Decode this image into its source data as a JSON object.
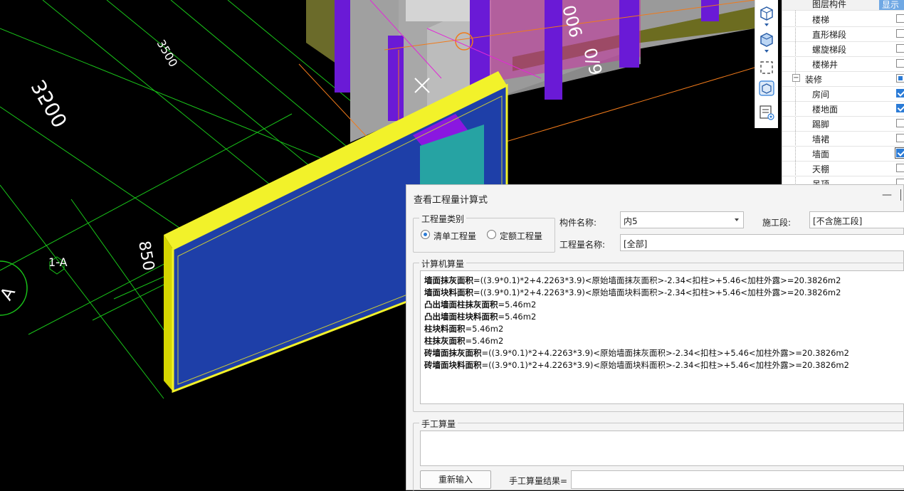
{
  "viewport": {
    "dimensions": [
      "3500",
      "3500",
      "850"
    ],
    "axis_label": "1-A",
    "axis_bubble": "A",
    "wall_text_1": "006",
    "wall_text_2": "0/9"
  },
  "layer_panel": {
    "header_label": "图层构件",
    "header_button": "显示",
    "items": [
      {
        "label": "楼梯",
        "checked": false
      },
      {
        "label": "直形梯段",
        "checked": false
      },
      {
        "label": "螺旋梯段",
        "checked": false
      },
      {
        "label": "楼梯井",
        "checked": false
      },
      {
        "label": "装修",
        "checked": "partial",
        "expander": "−"
      },
      {
        "label": "房间",
        "checked": true
      },
      {
        "label": "楼地面",
        "checked": true
      },
      {
        "label": "踢脚",
        "checked": false
      },
      {
        "label": "墙裙",
        "checked": false
      },
      {
        "label": "墙面",
        "checked": true
      },
      {
        "label": "天棚",
        "checked": false
      },
      {
        "label": "吊顶",
        "checked": false
      }
    ]
  },
  "toolbar_icons": [
    "cube-icon",
    "chevron-down-icon",
    "cube-solid-icon",
    "chevron-down-icon",
    "select-box-icon",
    "view-3d-icon",
    "list-view-icon"
  ],
  "dialog": {
    "title": "查看工程量计算式",
    "quantity_type": {
      "legend": "工程量类别",
      "option1": "清单工程量",
      "option2": "定额工程量",
      "selected": "option1"
    },
    "component_name_label": "构件名称:",
    "component_name_value": "内5",
    "stage_label": "施工段:",
    "stage_value": "[不含施工段]",
    "quantity_name_label": "工程量名称:",
    "quantity_name_value": "[全部]",
    "computer_calc": {
      "legend": "计算机算量",
      "lines": [
        {
          "name": "墙面抹灰面积",
          "expr": "=((3.9*0.1)*2+4.2263*3.9)<原始墙面抹灰面积>-2.34<扣柱>+5.46<加柱外露>=20.3826m2"
        },
        {
          "name": "墙面块料面积",
          "expr": "=((3.9*0.1)*2+4.2263*3.9)<原始墙面块料面积>-2.34<扣柱>+5.46<加柱外露>=20.3826m2"
        },
        {
          "name": "凸出墙面柱抹灰面积",
          "expr": "=5.46m2"
        },
        {
          "name": "凸出墙面柱块料面积",
          "expr": "=5.46m2"
        },
        {
          "name": "柱块料面积",
          "expr": "=5.46m2"
        },
        {
          "name": "柱抹灰面积",
          "expr": "=5.46m2"
        },
        {
          "name": "砖墙面抹灰面积",
          "expr": "=((3.9*0.1)*2+4.2263*3.9)<原始墙面抹灰面积>-2.34<扣柱>+5.46<加柱外露>=20.3826m2"
        },
        {
          "name": "砖墙面块料面积",
          "expr": "=((3.9*0.1)*2+4.2263*3.9)<原始墙面块料面积>-2.34<扣柱>+5.46<加柱外露>=20.3826m2"
        }
      ]
    },
    "manual_calc": {
      "legend": "手工算量",
      "reinput_button": "重新输入",
      "result_label": "手工算量结果=",
      "result_value": ""
    },
    "minimize_glyph": "—"
  }
}
